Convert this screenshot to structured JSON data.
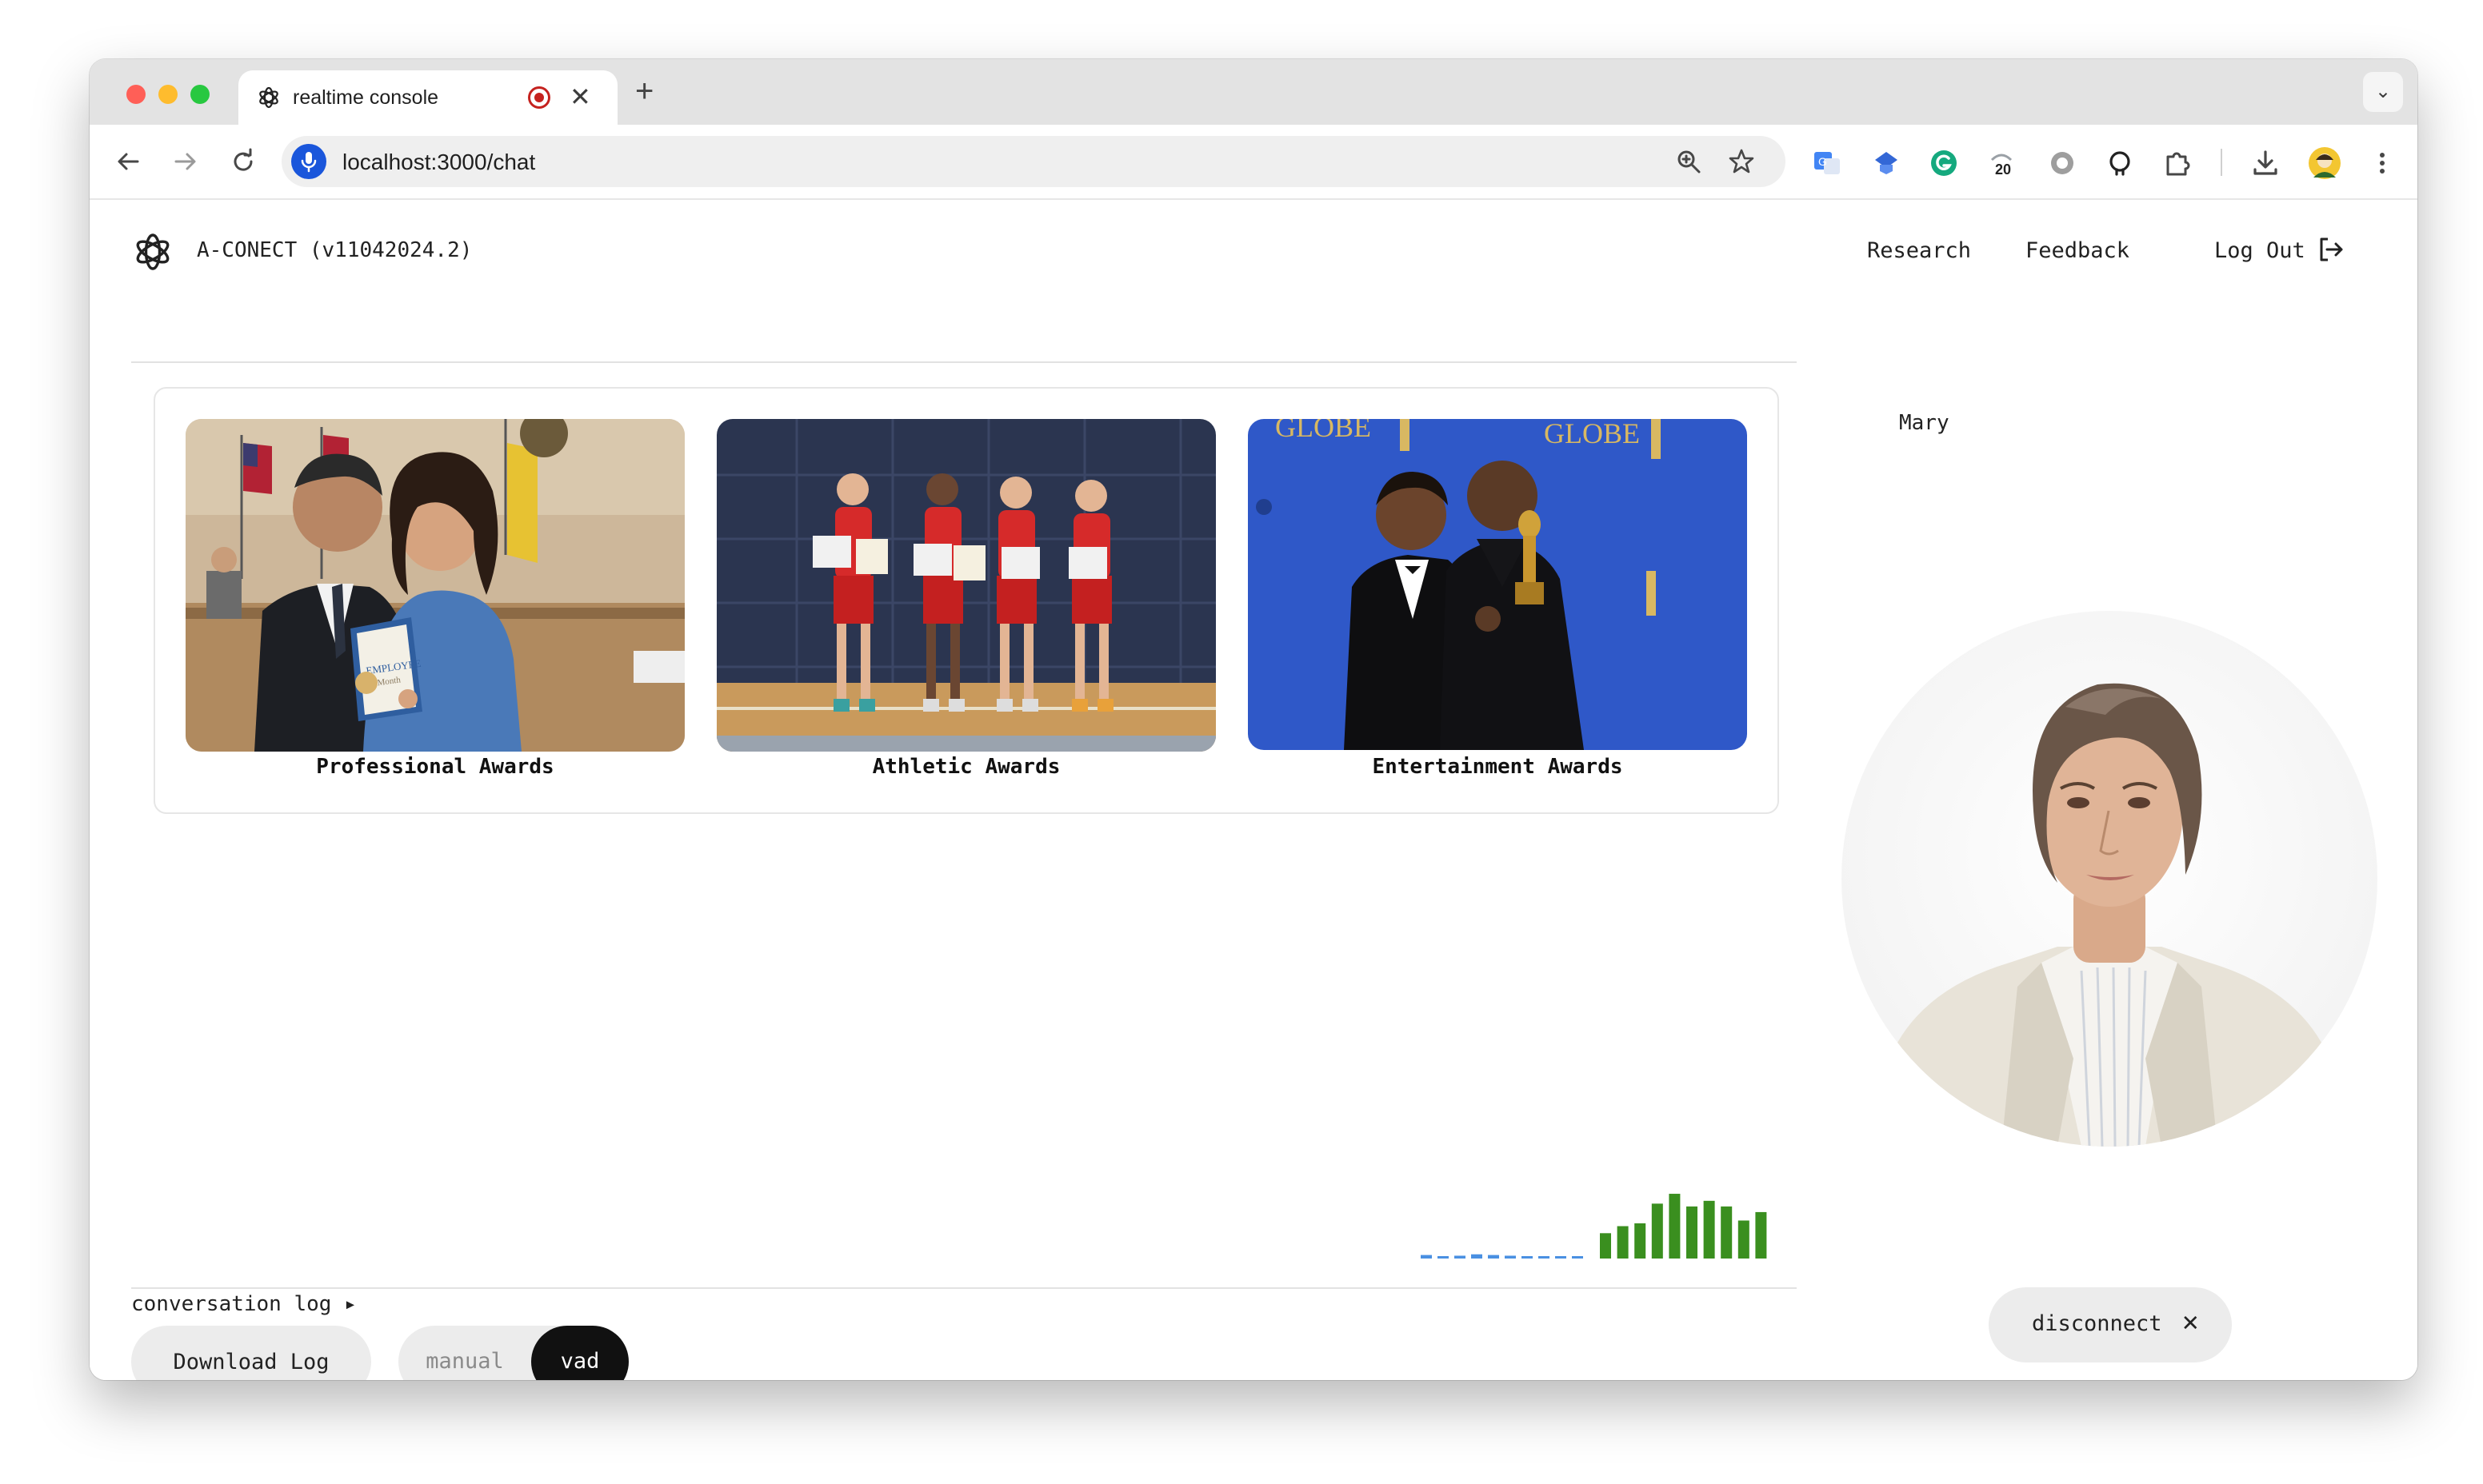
{
  "browser": {
    "tab_title": "realtime console",
    "tab_close": "✕",
    "new_tab": "+",
    "tab_menu": "⌄",
    "url": "localhost:3000/chat",
    "extension_badge": "20",
    "icons": [
      "back-icon",
      "forward-icon",
      "reload-icon",
      "mic-icon",
      "zoom-icon",
      "star-icon",
      "translate-icon",
      "extension-icon",
      "grammarly-icon",
      "extension-counter-icon",
      "circle-icon",
      "github-icon",
      "puzzle-icon",
      "download-icon",
      "profile-icon",
      "more-icon"
    ]
  },
  "app": {
    "title": "A-CONECT (v11042024.2)",
    "nav": {
      "research": "Research",
      "feedback": "Feedback",
      "logout": "Log Out"
    },
    "agent_name": "Mary"
  },
  "gallery": {
    "cards": [
      {
        "label": "Professional Awards"
      },
      {
        "label": "Athletic Awards"
      },
      {
        "label": "Entertainment Awards",
        "sign_text": "GLOBE"
      }
    ]
  },
  "footer": {
    "conversation_log": "conversation log ▸",
    "download_log": "Download Log",
    "mode_manual": "manual",
    "mode_vad": "vad",
    "mode_selected": "vad",
    "disconnect": "disconnect",
    "disconnect_icon": "✕"
  },
  "audio_visualizer": {
    "input_levels": [
      0.05,
      0.03,
      0.04,
      0.06,
      0.05,
      0.04,
      0.03,
      0.02,
      0.02,
      0.02
    ],
    "output_levels": [
      0.36,
      0.46,
      0.5,
      0.78,
      0.92,
      0.74,
      0.82,
      0.74,
      0.54,
      0.66
    ],
    "input_color": "#4a90e2",
    "output_color": "#3a8f1f"
  }
}
